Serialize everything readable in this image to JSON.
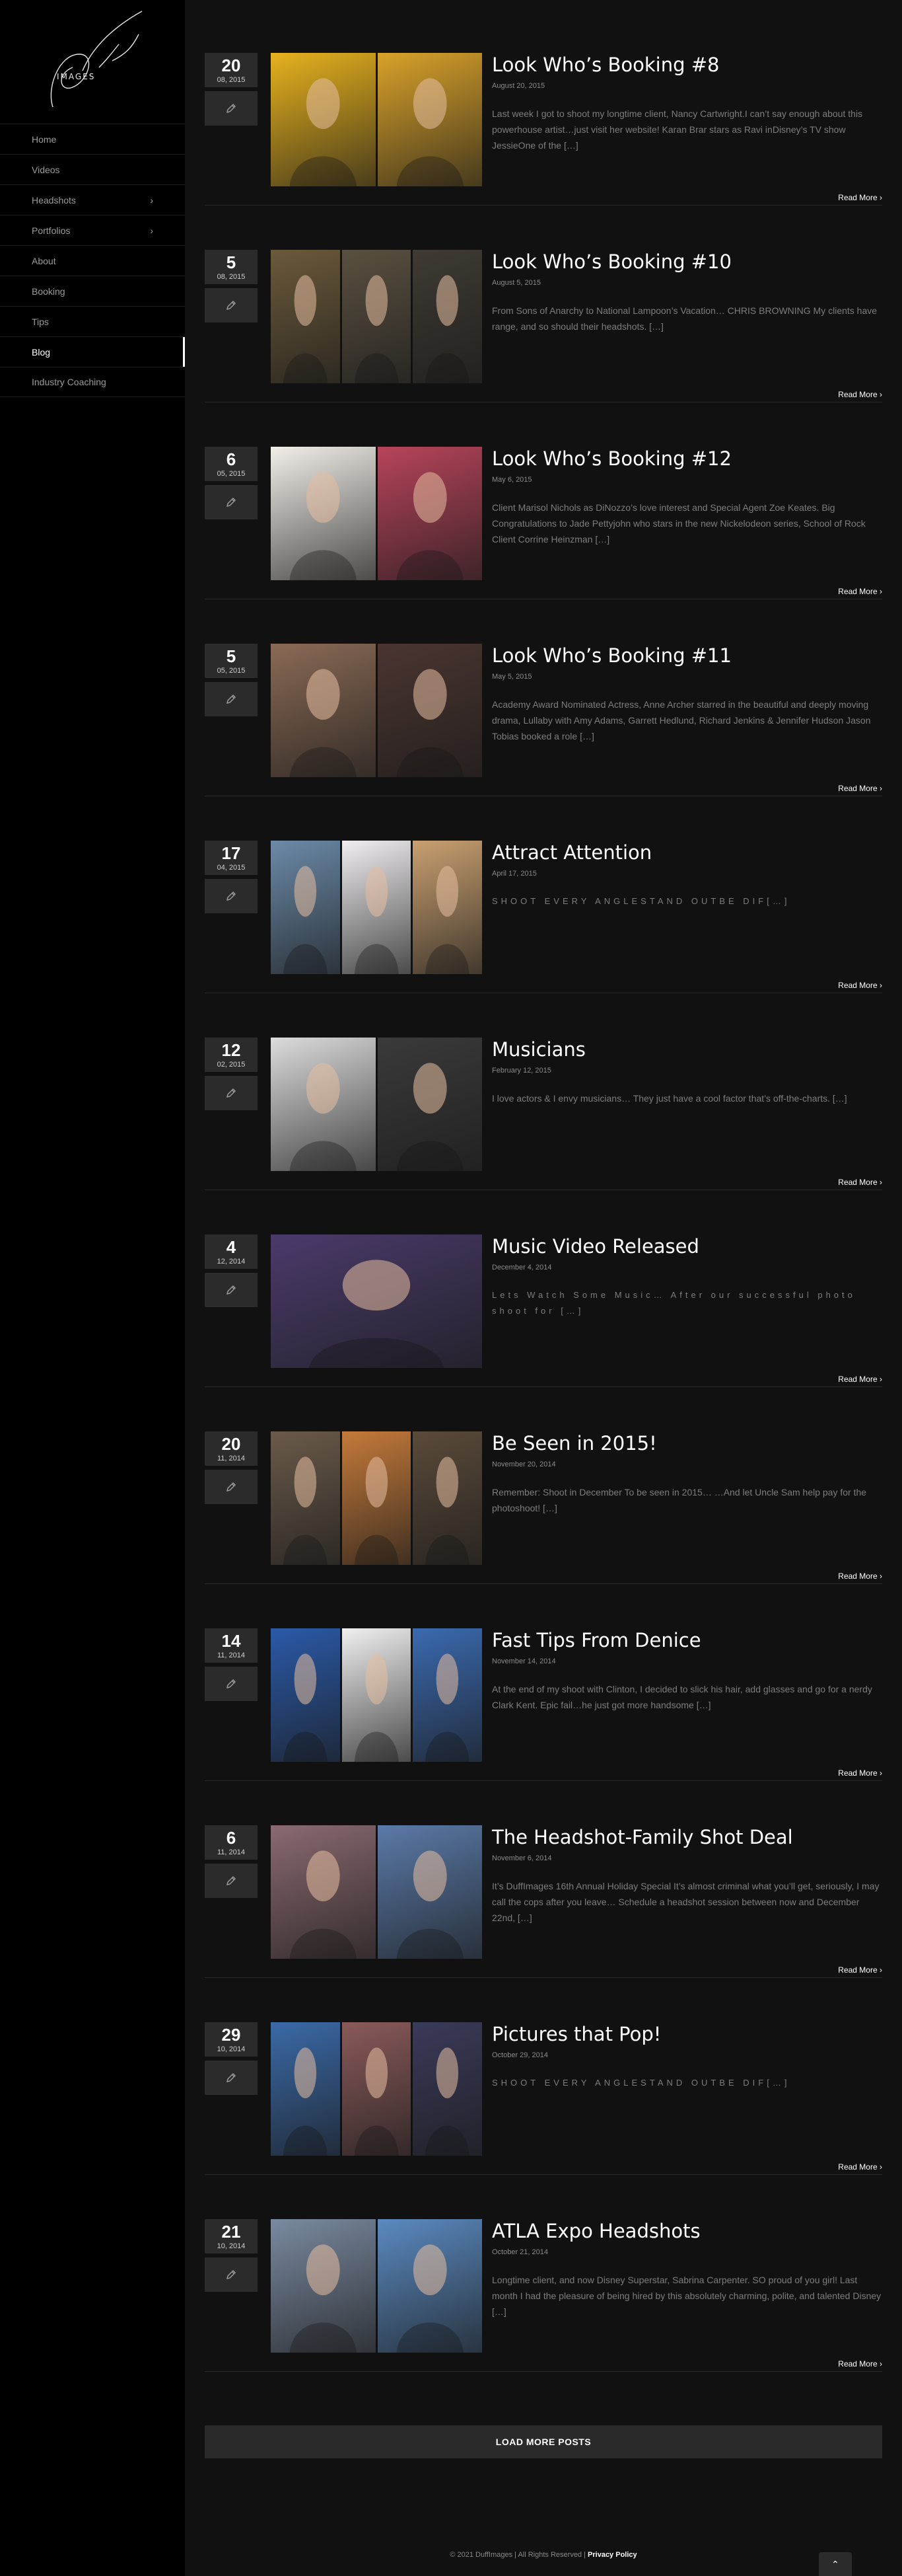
{
  "brand": {
    "logo_text": "IMAGES"
  },
  "nav": [
    {
      "label": "Home",
      "has_sub": false,
      "active": false
    },
    {
      "label": "Videos",
      "has_sub": false,
      "active": false
    },
    {
      "label": "Headshots",
      "has_sub": true,
      "active": false
    },
    {
      "label": "Portfolios",
      "has_sub": true,
      "active": false
    },
    {
      "label": "About",
      "has_sub": false,
      "active": false
    },
    {
      "label": "Booking",
      "has_sub": false,
      "active": false
    },
    {
      "label": "Tips",
      "has_sub": false,
      "active": false
    },
    {
      "label": "Blog",
      "has_sub": false,
      "active": true
    },
    {
      "label": "Industry Coaching",
      "has_sub": false,
      "active": false
    }
  ],
  "posts": [
    {
      "day": "20",
      "monthyear": "08, 2015",
      "title": "Look Who’s Booking #8",
      "date": "August 20, 2015",
      "excerpt": "Last week I got to shoot my longtime client, Nancy Cartwright.I can’t say enough about this powerhouse artist…just visit her website! Karan Brar stars as Ravi inDisney’s TV show JessieOne of the […]",
      "spaced": false,
      "panels": [
        "#e7b21e",
        "#d9a22a"
      ]
    },
    {
      "day": "5",
      "monthyear": "08, 2015",
      "title": "Look Who’s Booking #10",
      "date": "August 5, 2015",
      "excerpt": "From Sons of Anarchy to National Lampoon’s Vacation…  CHRIS BROWNING My clients have range, and so should their headshots. […]",
      "spaced": false,
      "panels": [
        "#6b5a3a",
        "#5a5040",
        "#3f3a33"
      ]
    },
    {
      "day": "6",
      "monthyear": "05, 2015",
      "title": "Look Who’s Booking #12",
      "date": "May 6, 2015",
      "excerpt": "Client Marisol Nichols as DiNozzo’s love interest and Special Agent Zoe Keates. Big Congratulations to Jade Pettyjohn who stars in the new Nickelodeon series, School of Rock Client Corrine Heinzman […]",
      "spaced": false,
      "panels": [
        "#f2efe9",
        "#b7445a"
      ]
    },
    {
      "day": "5",
      "monthyear": "05, 2015",
      "title": "Look Who’s Booking #11",
      "date": "May 5, 2015",
      "excerpt": "Academy Award Nominated Actress, Anne Archer starred in the beautiful and deeply moving drama, Lullaby with Amy Adams, Garrett Hedlund, Richard Jenkins & Jennifer Hudson Jason Tobias booked a role […]",
      "spaced": false,
      "panels": [
        "#8a6a55",
        "#4a3530"
      ]
    },
    {
      "day": "17",
      "monthyear": "04, 2015",
      "title": "Attract Attention",
      "date": "April 17, 2015",
      "excerpt": "SHOOT EVERY ANGLESTAND OUTBE DIF[…]",
      "spaced": true,
      "panels": [
        "#6b8aa8",
        "#f0eef0",
        "#c9a070"
      ]
    },
    {
      "day": "12",
      "monthyear": "02, 2015",
      "title": "Musicians",
      "date": "February 12, 2015",
      "excerpt": "I love actors  &   I envy musicians… They just have a cool factor that’s off-the-charts.   […]",
      "spaced": false,
      "panels": [
        "#dcdcdc",
        "#3a3a3a"
      ]
    },
    {
      "day": "4",
      "monthyear": "12, 2014",
      "title": "Music Video Released",
      "date": "December 4, 2014",
      "excerpt": "Lets Watch Some Music… After our successful photo shoot for […]",
      "spaced": true,
      "panels": [
        "#4a3a6a"
      ]
    },
    {
      "day": "20",
      "monthyear": "11, 2014",
      "title": "Be Seen in 2015!",
      "date": "November 20, 2014",
      "excerpt": "Remember: Shoot in December To be seen in 2015…    …And let Uncle Sam help pay for the photoshoot! […]",
      "spaced": false,
      "panels": [
        "#6a5a4a",
        "#c47a3a",
        "#5a4a3a"
      ]
    },
    {
      "day": "14",
      "monthyear": "11, 2014",
      "title": "Fast Tips From Denice",
      "date": "November 14, 2014",
      "excerpt": "At the end of my shoot with Clinton, I decided to slick his hair, add glasses and go for a nerdy Clark Kent. Epic fail…he just got more handsome […]",
      "spaced": false,
      "panels": [
        "#2a5aa8",
        "#f0f0f0",
        "#3a6ab0"
      ]
    },
    {
      "day": "6",
      "monthyear": "11, 2014",
      "title": "The Headshot-Family Shot Deal",
      "date": "November 6, 2014",
      "excerpt": "It’s DuffImages 16th Annual Holiday Special It’s almost criminal what you’ll get, seriously, I may call the cops after you leave…  Schedule a headshot session between now and December 22nd, […]",
      "spaced": false,
      "panels": [
        "#8a6a70",
        "#5a7aa8"
      ]
    },
    {
      "day": "29",
      "monthyear": "10, 2014",
      "title": "Pictures that Pop!",
      "date": "October 29, 2014",
      "excerpt": "SHOOT EVERY ANGLESTAND OUTBE DIF[…]",
      "spaced": true,
      "panels": [
        "#3a6aa8",
        "#8a5a5a",
        "#3a3a5a"
      ]
    },
    {
      "day": "21",
      "monthyear": "10, 2014",
      "title": "ATLA Expo Headshots",
      "date": "October 21, 2014",
      "excerpt": "Longtime client, and now Disney Superstar, Sabrina Carpenter. SO proud of you girl! Last month I had the pleasure of being hired by this absolutely charming, polite, and talented Disney […]",
      "spaced": false,
      "panels": [
        "#7a8aa0",
        "#5a8ac0"
      ]
    }
  ],
  "read_more": "Read More",
  "load_more": "LOAD MORE POSTS",
  "footer": {
    "copyright": "© 2021 DuffImages | All Rights Reserved |",
    "policy": "Privacy Policy"
  }
}
